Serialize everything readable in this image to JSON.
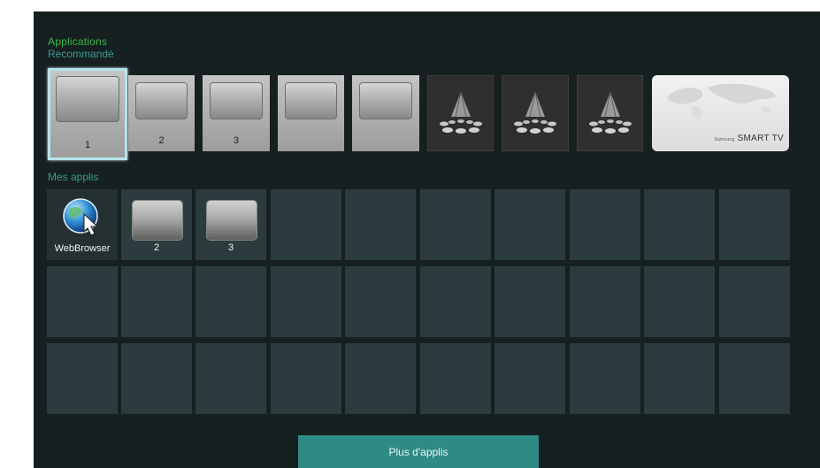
{
  "sections": {
    "applications": "Applications",
    "recommended": "Recommandé",
    "my_apps": "Mes applis"
  },
  "recommended": {
    "items": [
      {
        "label": "1",
        "state": "selected"
      },
      {
        "label": "2"
      },
      {
        "label": "3"
      },
      {
        "label": ""
      },
      {
        "label": ""
      },
      {
        "label": "",
        "placeholder": true
      },
      {
        "label": "",
        "placeholder": true
      },
      {
        "label": "",
        "placeholder": true
      }
    ],
    "banner": {
      "samsung": "Samsung",
      "smart_tv": "SMART TV"
    }
  },
  "my_apps": {
    "items": [
      {
        "label": "WebBrowser",
        "icon": "globe-cursor-icon"
      },
      {
        "label": "2"
      },
      {
        "label": "3"
      }
    ]
  },
  "more_button": "Plus d'applis",
  "colors": {
    "background": "#162020",
    "header_green": "#38b94a",
    "accent_teal": "#2f8a83",
    "grid_cell": "#2c3c3e"
  }
}
